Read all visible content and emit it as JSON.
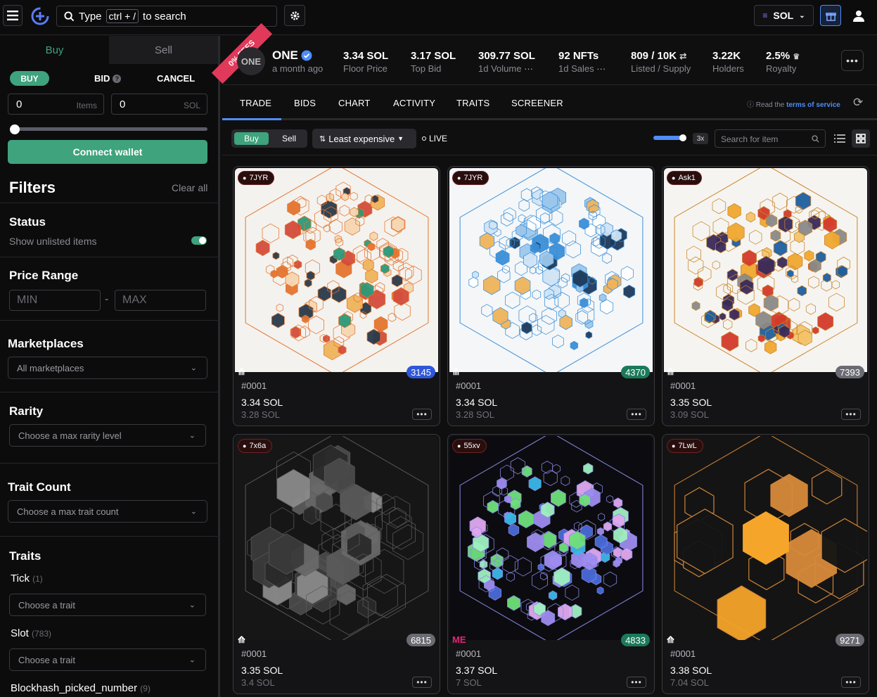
{
  "topbar": {
    "search_prefix": "Type",
    "search_key": "ctrl + /",
    "search_suffix": "to search",
    "currency": "SOL"
  },
  "sidebar": {
    "tabs": [
      "Buy",
      "Sell"
    ],
    "order_types": [
      "BUY",
      "BID",
      "CANCEL"
    ],
    "items_value": "0",
    "items_unit": "Items",
    "sol_value": "0",
    "sol_unit": "SOL",
    "connect_label": "Connect wallet",
    "filters_title": "Filters",
    "clear_all": "Clear all",
    "status_title": "Status",
    "show_unlisted": "Show unlisted items",
    "price_title": "Price Range",
    "min_placeholder": "MIN",
    "max_placeholder": "MAX",
    "price_sep": "-",
    "marketplaces_title": "Marketplaces",
    "marketplaces_value": "All marketplaces",
    "rarity_title": "Rarity",
    "rarity_placeholder": "Choose a max rarity level",
    "trait_count_title": "Trait Count",
    "trait_count_placeholder": "Choose a max trait count",
    "traits_title": "Traits",
    "traits": [
      {
        "name": "Tick",
        "count": "(1)",
        "placeholder": "Choose a trait"
      },
      {
        "name": "Slot",
        "count": "(783)",
        "placeholder": "Choose a trait"
      },
      {
        "name": "Blockhash_picked_number",
        "count": "(9)"
      }
    ]
  },
  "collection": {
    "ribbon": "0% FEES",
    "avatar_text": "ONE",
    "name": "ONE",
    "updated": "a month ago",
    "stats": [
      {
        "value": "3.34 SOL",
        "label": "Floor Price"
      },
      {
        "value": "3.17 SOL",
        "label": "Top Bid"
      },
      {
        "value": "309.77 SOL",
        "label": "1d Volume"
      },
      {
        "value": "92 NFTs",
        "label": "1d Sales"
      },
      {
        "value": "809 / 10K",
        "label": "Listed / Supply"
      },
      {
        "value": "3.22K",
        "label": "Holders"
      },
      {
        "value": "2.5%",
        "label": "Royalty"
      }
    ]
  },
  "tabs": [
    "TRADE",
    "BIDS",
    "CHART",
    "ACTIVITY",
    "TRAITS",
    "SCREENER"
  ],
  "tos": {
    "prefix": "Read the",
    "link": "terms of service"
  },
  "toolbar": {
    "buy": "Buy",
    "sell": "Sell",
    "sort": "Least expensive",
    "live": "LIVE",
    "zoom": "3x",
    "search_placeholder": "Search for item"
  },
  "items": [
    {
      "owner": "7JYR",
      "rank": "3145",
      "rank_color": "#2f57d8",
      "number": "#0001",
      "price": "3.34 SOL",
      "sub": "3.28 SOL",
      "market": "tensor"
    },
    {
      "owner": "7JYR",
      "rank": "4370",
      "rank_color": "#1b7a5a",
      "number": "#0001",
      "price": "3.34 SOL",
      "sub": "3.28 SOL",
      "market": "tensor"
    },
    {
      "owner": "Ask1",
      "rank": "7393",
      "rank_color": "#6b6b73",
      "number": "#0001",
      "price": "3.35 SOL",
      "sub": "3.09 SOL",
      "market": "tensor"
    },
    {
      "owner": "7x6a",
      "rank": "6815",
      "rank_color": "#6b6b73",
      "number": "#0001",
      "price": "3.35 SOL",
      "sub": "3.4 SOL",
      "market": "tensor"
    },
    {
      "owner": "55xv",
      "rank": "4833",
      "rank_color": "#1b7a5a",
      "number": "#0001",
      "price": "3.37 SOL",
      "sub": "7 SOL",
      "market": "magiceden"
    },
    {
      "owner": "7LwL",
      "rank": "9271",
      "rank_color": "#6b6b73",
      "number": "#0001",
      "price": "3.38 SOL",
      "sub": "7.04 SOL",
      "market": "tensor"
    }
  ],
  "colors": {
    "accent": "#3fa37d",
    "active_tab": "#4f8df7",
    "ribbon": "#e0395a",
    "link": "#4f8df7"
  },
  "more_label": "•••"
}
